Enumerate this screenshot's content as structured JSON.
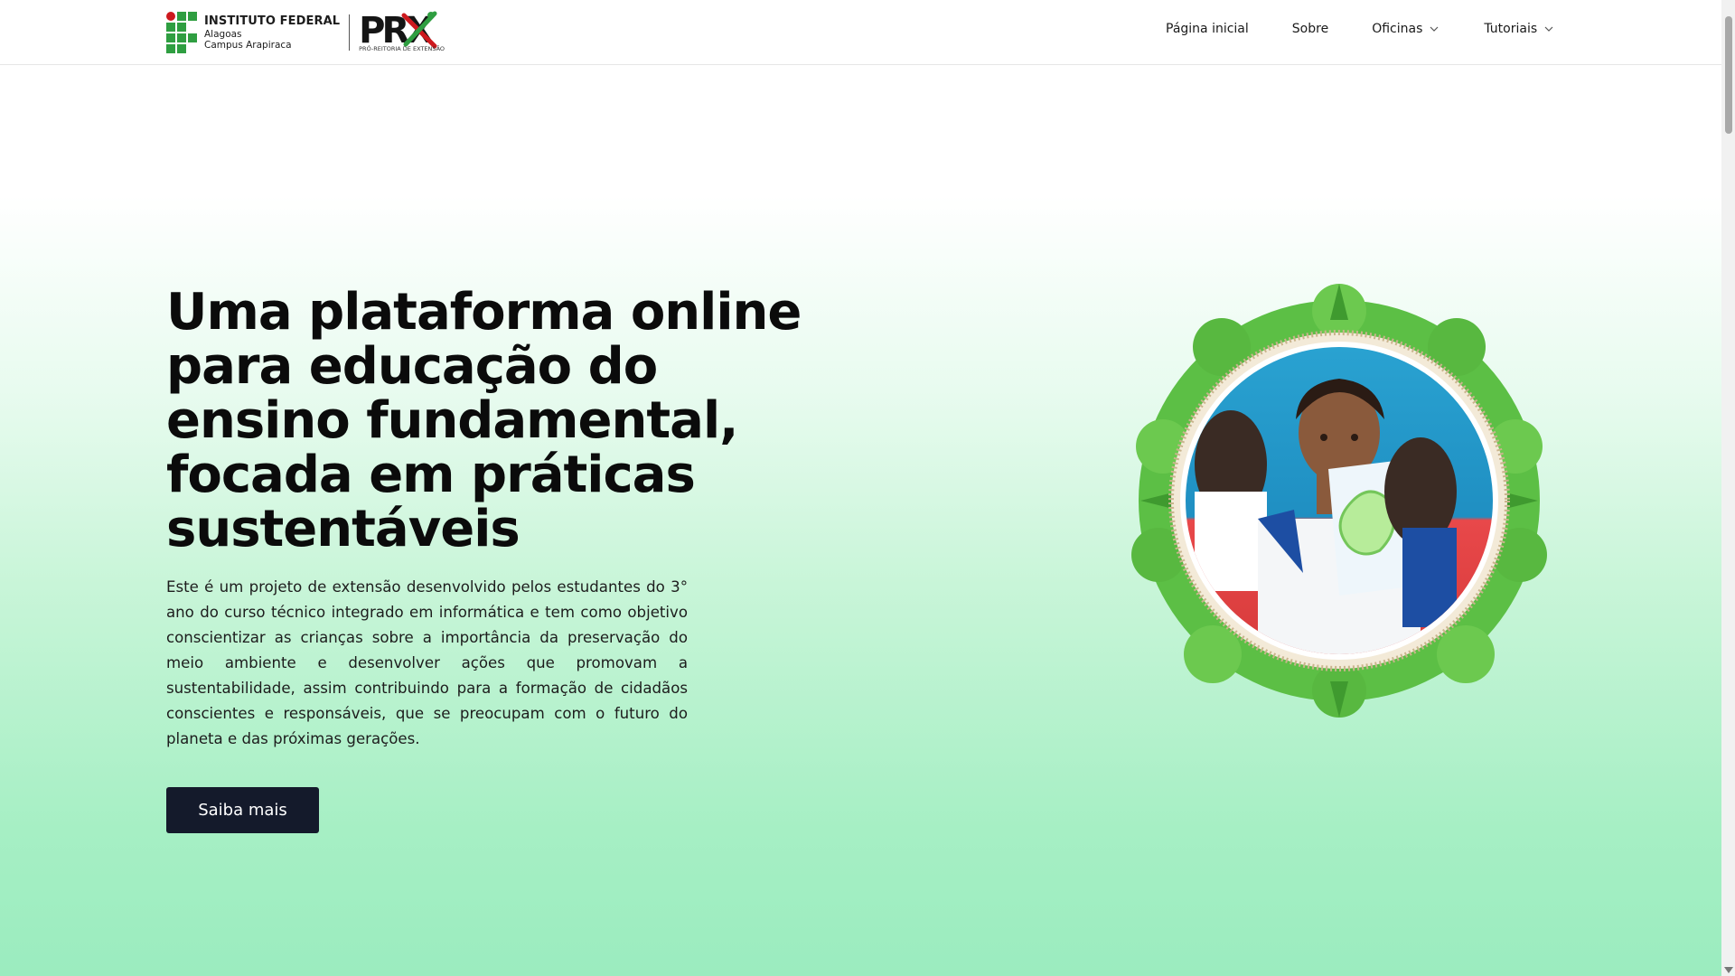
{
  "header": {
    "logo": {
      "institute_title": "INSTITUTO FEDERAL",
      "institute_state": "Alagoas",
      "institute_campus": "Campus Arapiraca",
      "prx_letters": "PRX",
      "prx_subtitle": "PRÓ-REITORIA DE EXTENSÃO"
    },
    "nav": {
      "items": [
        {
          "label": "Página inicial",
          "has_dropdown": false
        },
        {
          "label": "Sobre",
          "has_dropdown": false
        },
        {
          "label": "Oficinas",
          "has_dropdown": true
        },
        {
          "label": "Tutoriais",
          "has_dropdown": true
        }
      ]
    }
  },
  "hero": {
    "title": "Uma plataforma online para educação do ensino fundamental, focada em práticas sustentáveis",
    "description": "Este é um projeto de extensão desenvolvido pelos estudantes do 3° ano do curso técnico integrado em informática e tem como objetivo conscientizar as crianças sobre a importância da preservação do meio ambiente e desenvolver ações que promovam a sustentabilidade, assim contribuindo para a formação de cidadãos conscientes e responsáveis, que se preocupam com o futuro do planeta e das próximas gerações.",
    "cta_label": "Saiba mais"
  },
  "colors": {
    "brand_green": "#2f9e41",
    "brand_red": "#cd191e",
    "cta_background": "#141a2b",
    "gradient_bottom": "#9becbf"
  }
}
